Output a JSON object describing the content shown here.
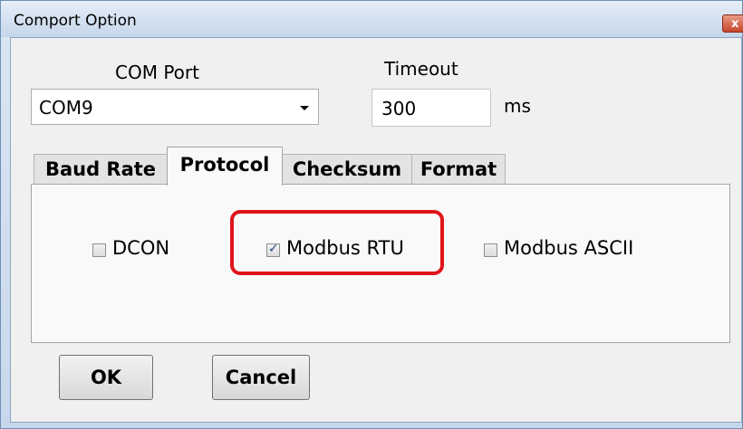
{
  "window": {
    "title": "Comport Option",
    "close_glyph": "x"
  },
  "com_port": {
    "label": "COM Port",
    "value": "COM9"
  },
  "timeout": {
    "label": "Timeout",
    "value": "300",
    "unit": "ms"
  },
  "tabs": [
    {
      "label": "Baud Rate",
      "active": false
    },
    {
      "label": "Protocol",
      "active": true
    },
    {
      "label": "Checksum",
      "active": false
    },
    {
      "label": "Format",
      "active": false
    }
  ],
  "protocol_options": [
    {
      "label": "DCON",
      "checked": false
    },
    {
      "label": "Modbus RTU",
      "checked": true
    },
    {
      "label": "Modbus ASCII",
      "checked": false
    }
  ],
  "buttons": {
    "ok": "OK",
    "cancel": "Cancel"
  },
  "colors": {
    "highlight": "#e0141b",
    "title_bar": "#d3e0f0",
    "dialog_bg": "#f0f0f0"
  }
}
